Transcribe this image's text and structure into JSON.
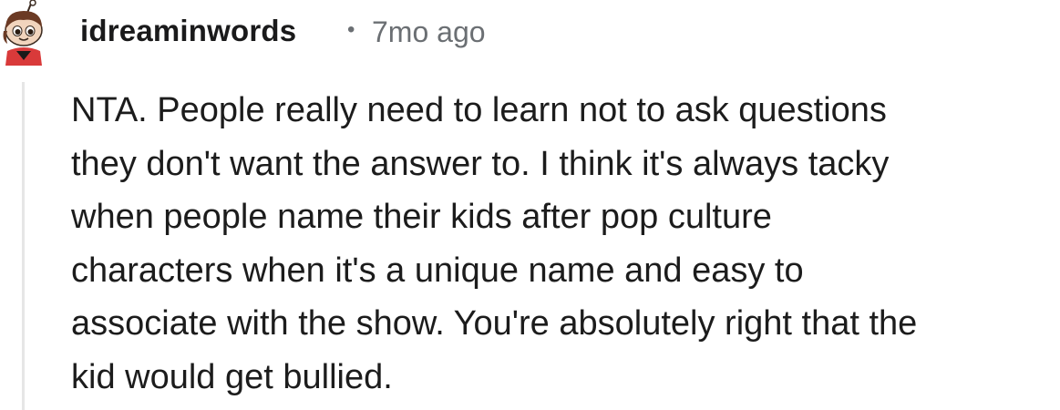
{
  "comment": {
    "author": "idreaminwords",
    "separator": "•",
    "timestamp": "7mo ago",
    "avatar_icon": "snoo-avatar-icon",
    "body": "NTA. People really need to learn not to ask questions\nthey don't want the answer to. I think it's always tacky\nwhen people name their kids after pop culture\ncharacters when it's a unique name and easy to\nassociate with the show. You're absolutely right that the\nkid would get bullied."
  },
  "colors": {
    "text": "#1c1c1c",
    "meta": "#6b6f73",
    "thread_line": "#e6e6e6",
    "avatar_accent": "#d93a3a"
  }
}
